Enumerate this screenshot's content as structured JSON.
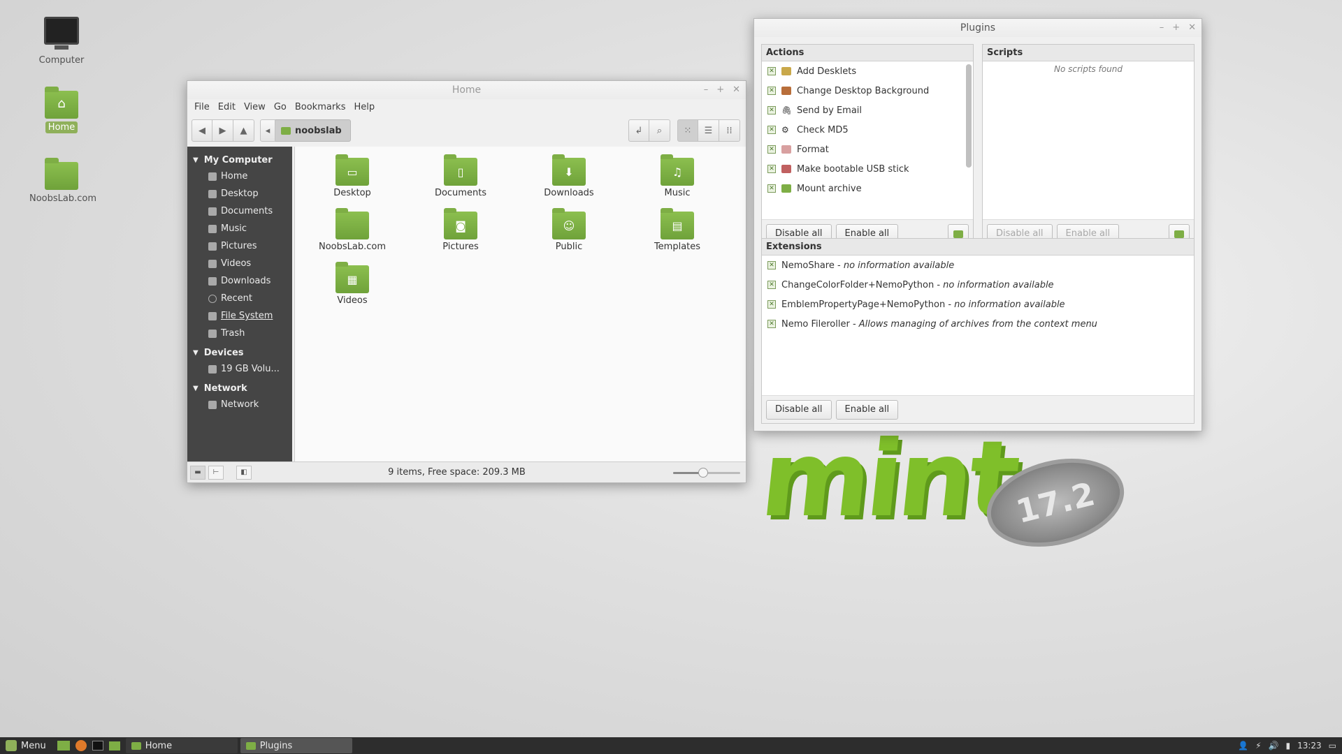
{
  "desktop": {
    "icons": [
      {
        "label": "Computer"
      },
      {
        "label": "Home"
      },
      {
        "label": "NoobsLab.com"
      }
    ]
  },
  "file_manager": {
    "title": "Home",
    "menu": [
      "File",
      "Edit",
      "View",
      "Go",
      "Bookmarks",
      "Help"
    ],
    "path_button": "noobslab",
    "sidebar": {
      "sections": [
        {
          "title": "My Computer",
          "items": [
            "Home",
            "Desktop",
            "Documents",
            "Music",
            "Pictures",
            "Videos",
            "Downloads",
            "Recent",
            "File System",
            "Trash"
          ]
        },
        {
          "title": "Devices",
          "items": [
            "19 GB Volu..."
          ]
        },
        {
          "title": "Network",
          "items": [
            "Network"
          ]
        }
      ]
    },
    "files": [
      {
        "name": "Desktop",
        "icon": "desktop-icon"
      },
      {
        "name": "Documents",
        "icon": "document-icon"
      },
      {
        "name": "Downloads",
        "icon": "download-arrow-icon"
      },
      {
        "name": "Music",
        "icon": "music-note-icon"
      },
      {
        "name": "NoobsLab.com",
        "icon": "folder-icon"
      },
      {
        "name": "Pictures",
        "icon": "camera-icon"
      },
      {
        "name": "Public",
        "icon": "person-icon"
      },
      {
        "name": "Templates",
        "icon": "template-icon"
      },
      {
        "name": "Videos",
        "icon": "film-icon"
      }
    ],
    "status": "9 items, Free space: 209.3 MB",
    "zoom_level": 0.45
  },
  "plugins": {
    "title": "Plugins",
    "actions": {
      "header": "Actions",
      "items": [
        "Add Desklets",
        "Change Desktop Background",
        "Send by Email",
        "Check MD5",
        "Format",
        "Make bootable USB stick",
        "Mount archive"
      ],
      "disable_label": "Disable all",
      "enable_label": "Enable all"
    },
    "scripts": {
      "header": "Scripts",
      "empty": "No scripts found",
      "disable_label": "Disable all",
      "enable_label": "Enable all"
    },
    "extensions": {
      "header": "Extensions",
      "items": [
        {
          "name": "NemoShare",
          "desc": "no information available"
        },
        {
          "name": "ChangeColorFolder+NemoPython",
          "desc": "no information available"
        },
        {
          "name": "EmblemPropertyPage+NemoPython",
          "desc": "no information available"
        },
        {
          "name": "Nemo Fileroller",
          "desc": "Allows managing of archives from the context menu"
        }
      ],
      "disable_label": "Disable all",
      "enable_label": "Enable all"
    }
  },
  "taskbar": {
    "menu_label": "Menu",
    "windows": [
      {
        "label": "Home"
      },
      {
        "label": "Plugins"
      }
    ],
    "clock": "13:23"
  },
  "colors": {
    "accent": "#8fb05a",
    "folder": "#7eae45",
    "sidebar_bg": "#454545",
    "taskbar_bg": "#2d2d2d"
  }
}
